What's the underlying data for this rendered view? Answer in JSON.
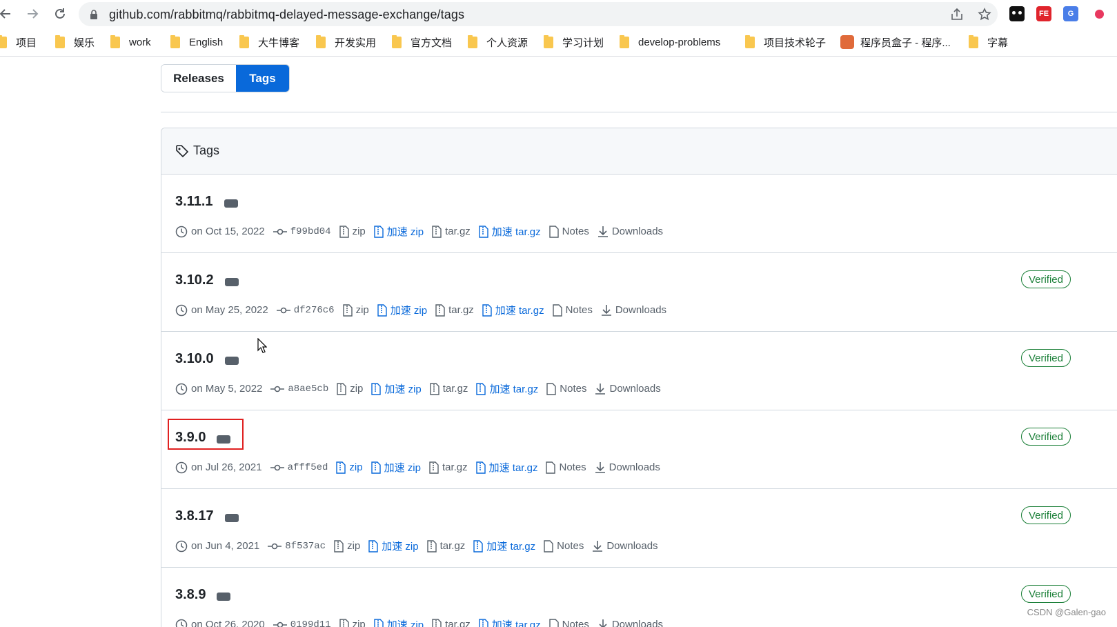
{
  "browser": {
    "url": "github.com/rabbitmq/rabbitmq-delayed-message-exchange/tags"
  },
  "bookmarks": [
    "项目",
    "娱乐",
    "work",
    "English",
    "大牛博客",
    "开发实用",
    "官方文档",
    "个人资源",
    "学习计划",
    "develop-problems",
    "项目技术轮子",
    "程序员盒子 - 程序...",
    "字幕"
  ],
  "segmented": {
    "releases": "Releases",
    "tags": "Tags"
  },
  "tags_box": {
    "title": "Tags"
  },
  "labels": {
    "zip": "zip",
    "fast_zip": "加速 zip",
    "targz": "tar.gz",
    "fast_targz": "加速 tar.gz",
    "notes": "Notes",
    "downloads": "Downloads",
    "verified": "Verified"
  },
  "tags": [
    {
      "name": "3.11.1",
      "date": "on Oct 15, 2022",
      "sha": "f99bd04",
      "verified": false
    },
    {
      "name": "3.10.2",
      "date": "on May 25, 2022",
      "sha": "df276c6",
      "verified": true
    },
    {
      "name": "3.10.0",
      "date": "on May 5, 2022",
      "sha": "a8ae5cb",
      "verified": true
    },
    {
      "name": "3.9.0",
      "date": "on Jul 26, 2021",
      "sha": "afff5ed",
      "verified": true
    },
    {
      "name": "3.8.17",
      "date": "on Jun 4, 2021",
      "sha": "8f537ac",
      "verified": true
    },
    {
      "name": "3.8.9",
      "date": "on Oct 26, 2020",
      "sha": "0199d11",
      "verified": true
    }
  ],
  "watermark": "CSDN @Galen-gao"
}
